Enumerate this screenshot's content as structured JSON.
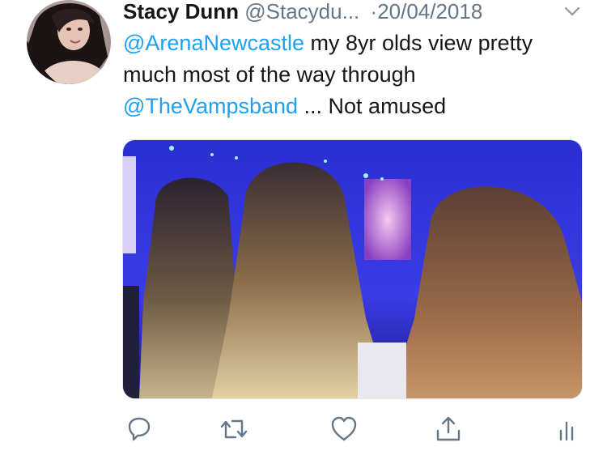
{
  "tweet": {
    "author_name": "Stacy Dunn",
    "author_handle": "@Stacydu...",
    "separator": "·",
    "date": "20/04/2018",
    "mention_1": "@ArenaNewcastle",
    "text_1": " my 8yr olds view pretty much most of the way through ",
    "mention_2": "@TheVampsband",
    "text_2": " ... Not amused"
  },
  "icons": {
    "caret": "chevron-down-icon",
    "reply": "reply-icon",
    "retweet": "retweet-icon",
    "like": "heart-icon",
    "share": "share-icon",
    "analytics": "analytics-icon"
  },
  "colors": {
    "link": "#1da1f2",
    "secondary": "#657786",
    "icon": "#657786"
  }
}
